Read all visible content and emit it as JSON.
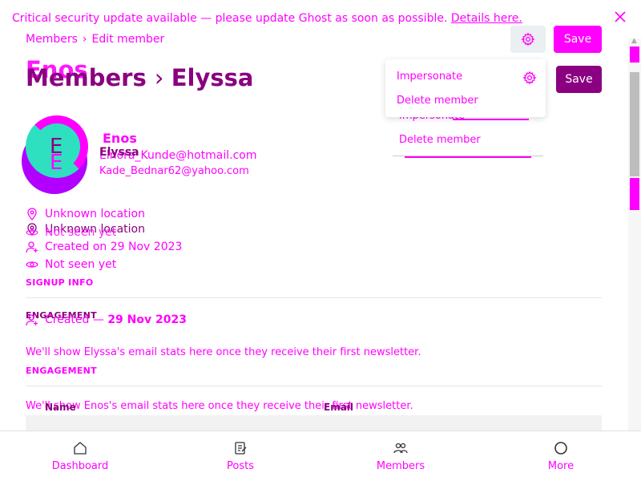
{
  "banner": {
    "text": "Critical security update available — please update Ghost as soon as possible.",
    "link": "Details here."
  },
  "breadcrumb": {
    "parent": "Members",
    "current": "Edit member"
  },
  "header": {
    "title_prefix": "Members",
    "title_name": "Elyssa",
    "title_ghost": "Enos",
    "save_label": "Save",
    "save_label_2": "Save"
  },
  "menu": {
    "items": [
      "Impersonate",
      "Delete member"
    ],
    "ghost_items": [
      "Impersonate",
      "Delete member"
    ]
  },
  "member": {
    "avatar_letter_1": "E",
    "avatar_letter_2": "E",
    "name_1": "Enos",
    "name_2": "Elyssa",
    "email_1": "Elnora_Kunde@hotmail.com",
    "email_2": "Kade_Bednar62@yahoo.com"
  },
  "info": {
    "location_1": "Unknown location",
    "location_2": "Unknown location",
    "seen_1": "Not seen yet",
    "created_1": "Created on 29 Nov 2023",
    "seen_2": "Not seen yet"
  },
  "sections": {
    "signup_info": "SIGNUP INFO",
    "engagement_ghost": "ENGAGEMENT",
    "created_prefix": "Created — ",
    "created_date": "29 Nov 2023",
    "para_1": "We'll show Elyssa's email stats here once they receive their first newsletter.",
    "engagement": "ENGAGEMENT",
    "para_2": "We'll show Enos's email stats here once they receive their first newsletter.",
    "col_name": "Name",
    "col_email": "Email"
  },
  "nav": [
    {
      "label": "Dashboard",
      "icon": "home-icon"
    },
    {
      "label": "Posts",
      "icon": "posts-icon"
    },
    {
      "label": "Members",
      "icon": "members-icon"
    },
    {
      "label": "More",
      "icon": "more-icon"
    }
  ],
  "colors": {
    "accent": "#ff00ff",
    "dark_accent": "#8a0080",
    "avatar_bg": "#2ee0c0"
  }
}
